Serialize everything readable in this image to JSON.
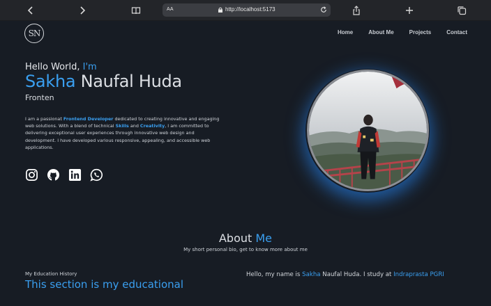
{
  "browser": {
    "text_size_label": "AA",
    "url": "http://localhost:5173"
  },
  "nav": {
    "logo": "SN",
    "items": [
      "Home",
      "About Me",
      "Projects",
      "Contact"
    ]
  },
  "hero": {
    "hello_prefix": "Hello World, ",
    "hello_accent": "I'm",
    "first_name": "Sakha",
    "last_name": " Naufal Huda",
    "role": "Fronten",
    "description": {
      "p1": "I am a passionat ",
      "k1": "Frontend Developer",
      "p2": " dedicated to creating innovative and engaging web solutions. With a blend of technical ",
      "k2": "Skills",
      "p3": " and ",
      "k3": "Creativity",
      "p4": ", I am committed to delivering exceptional user experiences through innovative web design and development. I have developed various responsive, appealing, and accessible web applications."
    },
    "socials": [
      "instagram-icon",
      "github-icon",
      "linkedin-icon",
      "whatsapp-icon"
    ]
  },
  "about": {
    "title_prefix": "About ",
    "title_accent": "Me",
    "subtitle": "My short personal bio, get to know more about me",
    "edu_label": "My Education History",
    "edu_heading": "This section is my educational",
    "bio_prefix": "Hello, my name is ",
    "bio_name": "Sakha",
    "bio_mid": " Naufal Huda. I study at ",
    "bio_school": "Indraprasta PGRI"
  },
  "colors": {
    "background": "#171c24",
    "accent": "#3a9ff0",
    "text": "#dcdfe4"
  }
}
